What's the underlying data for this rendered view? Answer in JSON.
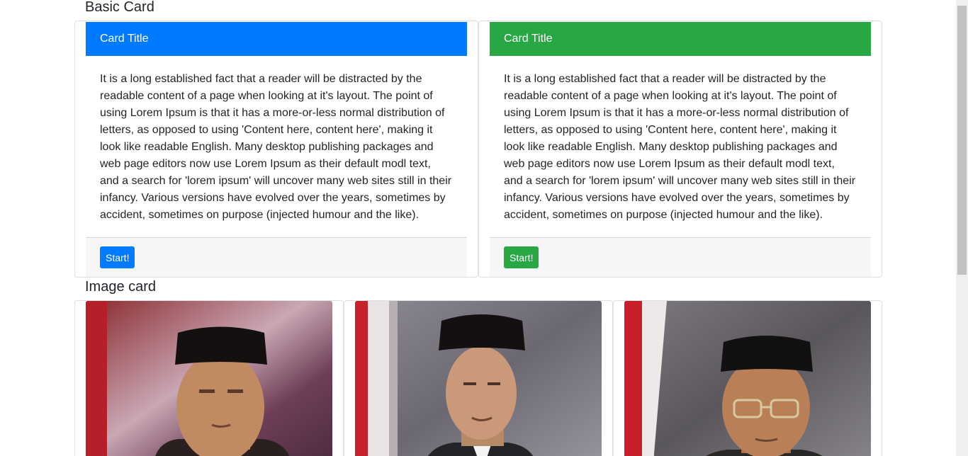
{
  "sections": {
    "basic_title": "Basic Card",
    "image_title": "Image card"
  },
  "cards": [
    {
      "title": "Card Title",
      "header_color": "#007bff",
      "body": "It is a long established fact that a reader will be distracted by the readable content of a page when looking at it's layout. The point of using Lorem Ipsum is that it has a more-or-less normal distribution of letters, as opposed to using 'Content here, content here', making it look like readable English. Many desktop publishing packages and web page editors now use Lorem Ipsum as their default modl text, and a search for 'lorem ipsum' will uncover many web sites still in their infancy. Various versions have evolved over the years, sometimes by accident, sometimes on purpose (injected humour and the like).",
      "button_label": "Start!"
    },
    {
      "title": "Card Title",
      "header_color": "#28a745",
      "body": "It is a long established fact that a reader will be distracted by the readable content of a page when looking at it's layout. The point of using Lorem Ipsum is that it has a more-or-less normal distribution of letters, as opposed to using 'Content here, content here', making it look like readable English. Many desktop publishing packages and web page editors now use Lorem Ipsum as their default modl text, and a search for 'lorem ipsum' will uncover many web sites still in their infancy. Various versions have evolved over the years, sometimes by accident, sometimes on purpose (injected humour and the like).",
      "button_label": "Start!"
    }
  ],
  "image_cards": [
    {
      "image": "portrait-photo-icon"
    },
    {
      "image": "portrait-photo-icon"
    },
    {
      "image": "portrait-photo-icon"
    }
  ]
}
